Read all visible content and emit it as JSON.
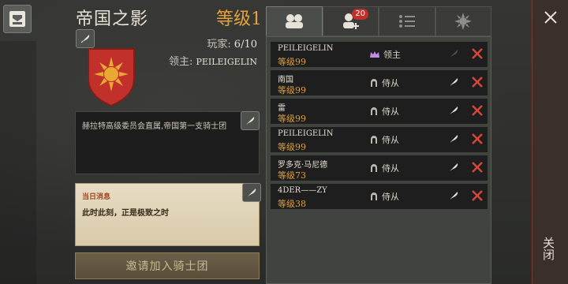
{
  "guild": {
    "name": "帝国之影",
    "level": "等级1",
    "players_label": "玩家:",
    "players_value": "6/10",
    "leader_label": "领主:",
    "leader_value": "PEILEIGELIN",
    "description": "赫拉特高级委员会直属,帝国第一支骑士团",
    "notice_title": "当日消息",
    "notice_text": "此时此刻，正是极致之时",
    "invite_label": "邀请加入骑士团"
  },
  "tabs": [
    {
      "icon": "members-icon"
    },
    {
      "icon": "add-member-icon",
      "badge": "20"
    },
    {
      "icon": "list-icon"
    },
    {
      "icon": "sun-emblem-icon"
    }
  ],
  "members": [
    {
      "name": "PEILEIGELIN",
      "level": "等级99",
      "rank": "领主",
      "rank_icon": "crown-icon"
    },
    {
      "name": "南国",
      "level": "等级99",
      "rank": "侍从",
      "rank_icon": "helmet-icon"
    },
    {
      "name": "雷",
      "level": "等级99",
      "rank": "侍从",
      "rank_icon": "helmet-icon"
    },
    {
      "name": "PEILEIGELIN",
      "level": "等级99",
      "rank": "侍从",
      "rank_icon": "helmet-icon"
    },
    {
      "name": "罗多克·马尼德",
      "level": "等级73",
      "rank": "侍从",
      "rank_icon": "helmet-icon"
    },
    {
      "name": "4DER——ZY",
      "level": "等级38",
      "rank": "侍从",
      "rank_icon": "helmet-icon"
    }
  ],
  "close_label": "关闭",
  "colors": {
    "accent": "#e3a33c",
    "danger": "#d3463a",
    "crest": "#c1302a"
  }
}
